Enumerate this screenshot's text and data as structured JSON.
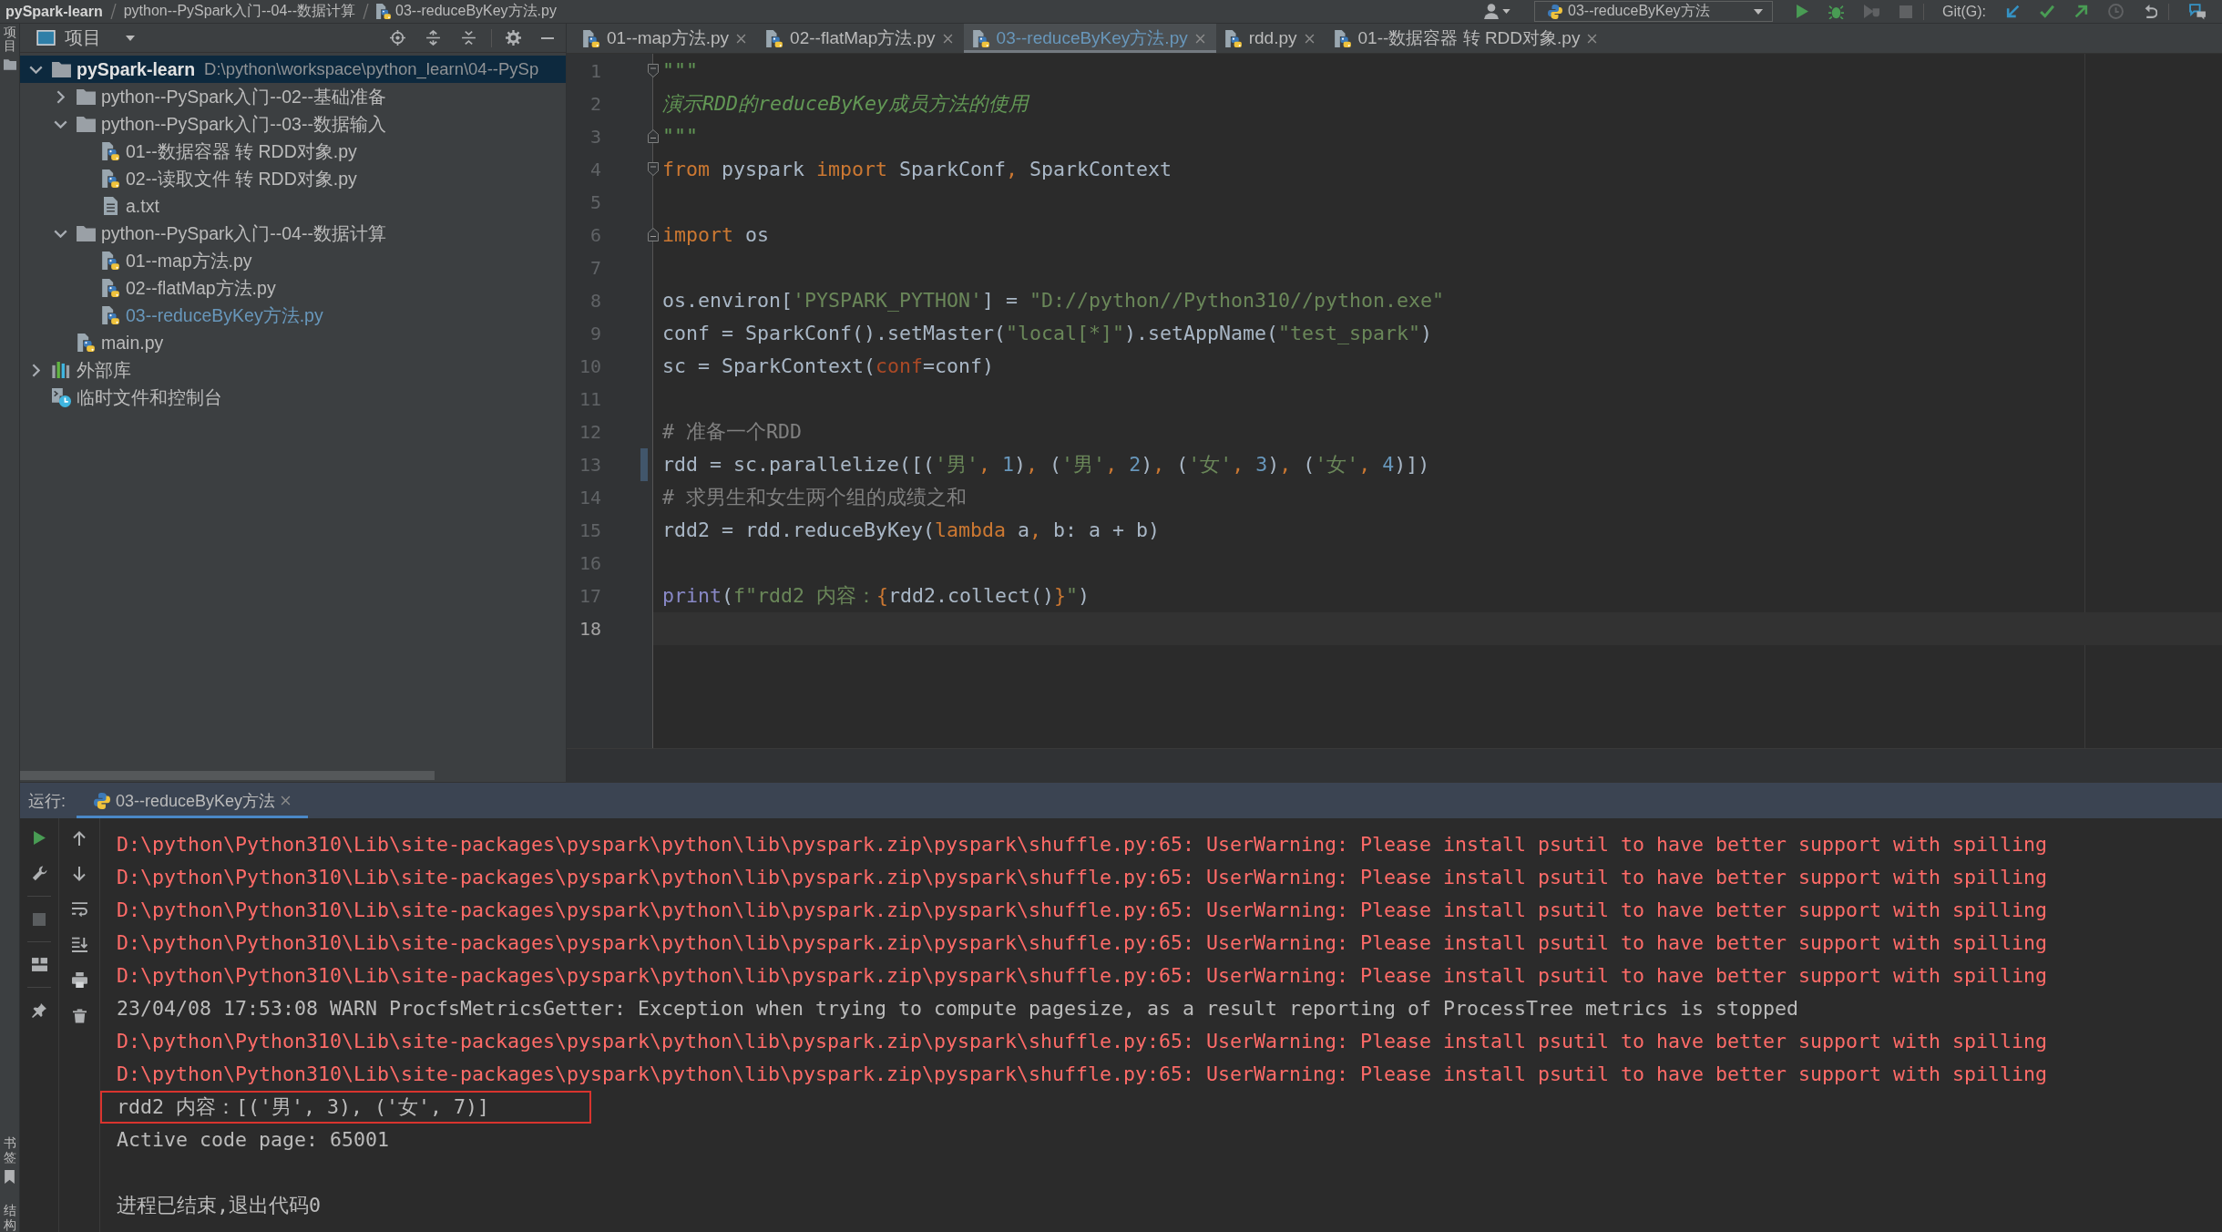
{
  "title_bar": {
    "breadcrumbs": [
      {
        "label": "pySpark-learn",
        "kind": "project"
      },
      {
        "label": "python--PySpark入门--04--数据计算",
        "kind": "folder"
      },
      {
        "label": "03--reduceByKey方法.py",
        "kind": "python"
      }
    ],
    "run_config": {
      "label": "03--reduceByKey方法"
    },
    "vcs_label": "Git(G):"
  },
  "tool_strip": {
    "top": [
      {
        "label": "项目",
        "kind": "project"
      }
    ],
    "bottom": [
      {
        "label": "书签",
        "kind": "bookmarks"
      },
      {
        "label": "结构",
        "kind": "structure"
      }
    ]
  },
  "project_panel": {
    "title": "项目",
    "tree": [
      {
        "label": "pySpark-learn",
        "path": "D:\\python\\workspace\\python_learn\\04--PySp",
        "kind": "project",
        "expanded": true,
        "selected": true,
        "modified": false,
        "children": [
          {
            "label": "python--PySpark入门--02--基础准备",
            "kind": "folder",
            "expanded": false,
            "selected": false,
            "modified": false
          },
          {
            "label": "python--PySpark入门--03--数据输入",
            "kind": "folder",
            "expanded": true,
            "selected": false,
            "modified": false,
            "children": [
              {
                "label": "01--数据容器 转 RDD对象.py",
                "kind": "python",
                "selected": false,
                "modified": false
              },
              {
                "label": "02--读取文件 转 RDD对象.py",
                "kind": "python",
                "selected": false,
                "modified": false
              },
              {
                "label": "a.txt",
                "kind": "text",
                "selected": false,
                "modified": false
              }
            ]
          },
          {
            "label": "python--PySpark入门--04--数据计算",
            "kind": "folder",
            "expanded": true,
            "selected": false,
            "modified": false,
            "children": [
              {
                "label": "01--map方法.py",
                "kind": "python",
                "selected": false,
                "modified": false
              },
              {
                "label": "02--flatMap方法.py",
                "kind": "python",
                "selected": false,
                "modified": false
              },
              {
                "label": "03--reduceByKey方法.py",
                "kind": "python",
                "selected": false,
                "modified": true
              }
            ]
          },
          {
            "label": "main.py",
            "kind": "python",
            "selected": false,
            "modified": false
          }
        ]
      },
      {
        "label": "外部库",
        "kind": "library",
        "expanded": false,
        "selected": false,
        "modified": false
      },
      {
        "label": "临时文件和控制台",
        "kind": "scratch",
        "selected": false,
        "modified": false
      }
    ]
  },
  "editor": {
    "tabs": [
      {
        "label": "01--map方法.py",
        "selected": false,
        "modified": false
      },
      {
        "label": "02--flatMap方法.py",
        "selected": false,
        "modified": false
      },
      {
        "label": "03--reduceByKey方法.py",
        "selected": true,
        "modified": true
      },
      {
        "label": "rdd.py",
        "selected": false,
        "modified": false
      },
      {
        "label": "01--数据容器 转 RDD对象.py",
        "selected": false,
        "modified": false
      }
    ],
    "lines": [
      {
        "number": "1",
        "fold_start": true,
        "fold_end": false,
        "current": false,
        "changed": false,
        "tokens": [
          {
            "kind": "docstring",
            "text": "\"\"\""
          }
        ]
      },
      {
        "number": "2",
        "fold_start": false,
        "fold_end": false,
        "current": false,
        "changed": false,
        "tokens": [
          {
            "kind": "docstring",
            "text": "演示RDD的reduceByKey成员方法的使用"
          }
        ]
      },
      {
        "number": "3",
        "fold_start": false,
        "fold_end": true,
        "current": false,
        "changed": false,
        "tokens": [
          {
            "kind": "docstring",
            "text": "\"\"\""
          }
        ]
      },
      {
        "number": "4",
        "fold_start": true,
        "fold_end": false,
        "current": false,
        "changed": false,
        "tokens": [
          {
            "kind": "keyword",
            "text": "from"
          },
          {
            "kind": "plain",
            "text": " pyspark "
          },
          {
            "kind": "keyword",
            "text": "import"
          },
          {
            "kind": "plain",
            "text": " SparkConf"
          },
          {
            "kind": "keyword",
            "text": ","
          },
          {
            "kind": "plain",
            "text": " SparkContext"
          }
        ]
      },
      {
        "number": "5",
        "fold_start": false,
        "fold_end": false,
        "current": false,
        "changed": false
      },
      {
        "number": "6",
        "fold_start": false,
        "fold_end": true,
        "current": false,
        "changed": false,
        "tokens": [
          {
            "kind": "keyword",
            "text": "import"
          },
          {
            "kind": "plain",
            "text": " os"
          }
        ]
      },
      {
        "number": "7",
        "fold_start": false,
        "fold_end": false,
        "current": false,
        "changed": false
      },
      {
        "number": "8",
        "fold_start": false,
        "fold_end": false,
        "current": false,
        "changed": false,
        "tokens": [
          {
            "kind": "plain",
            "text": "os.environ["
          },
          {
            "kind": "string",
            "text": "'PYSPARK_PYTHON'"
          },
          {
            "kind": "plain",
            "text": "] = "
          },
          {
            "kind": "string",
            "text": "\"D://python//Python310//python.exe\""
          }
        ]
      },
      {
        "number": "9",
        "fold_start": false,
        "fold_end": false,
        "current": false,
        "changed": false,
        "tokens": [
          {
            "kind": "plain",
            "text": "conf = SparkConf().setMaster("
          },
          {
            "kind": "string",
            "text": "\"local[*]\""
          },
          {
            "kind": "plain",
            "text": ").setAppName("
          },
          {
            "kind": "string",
            "text": "\"test_spark\""
          },
          {
            "kind": "plain",
            "text": ")"
          }
        ]
      },
      {
        "number": "10",
        "fold_start": false,
        "fold_end": false,
        "current": false,
        "changed": false,
        "tokens": [
          {
            "kind": "plain",
            "text": "sc = SparkContext("
          },
          {
            "kind": "param",
            "text": "conf"
          },
          {
            "kind": "plain",
            "text": "=conf)"
          }
        ]
      },
      {
        "number": "11",
        "fold_start": false,
        "fold_end": false,
        "current": false,
        "changed": false
      },
      {
        "number": "12",
        "fold_start": false,
        "fold_end": false,
        "current": false,
        "changed": false,
        "tokens": [
          {
            "kind": "comment",
            "text": "# 准备一个RDD"
          }
        ]
      },
      {
        "number": "13",
        "fold_start": false,
        "fold_end": false,
        "current": false,
        "changed": true,
        "tokens": [
          {
            "kind": "plain",
            "text": "rdd = sc.parallelize([("
          },
          {
            "kind": "string",
            "text": "'男'"
          },
          {
            "kind": "keyword",
            "text": ","
          },
          {
            "kind": "number",
            "text": " 1"
          },
          {
            "kind": "plain",
            "text": ")"
          },
          {
            "kind": "keyword",
            "text": ","
          },
          {
            "kind": "plain",
            "text": " ("
          },
          {
            "kind": "string",
            "text": "'男'"
          },
          {
            "kind": "keyword",
            "text": ","
          },
          {
            "kind": "number",
            "text": " 2"
          },
          {
            "kind": "plain",
            "text": ")"
          },
          {
            "kind": "keyword",
            "text": ","
          },
          {
            "kind": "plain",
            "text": " ("
          },
          {
            "kind": "string",
            "text": "'女'"
          },
          {
            "kind": "keyword",
            "text": ","
          },
          {
            "kind": "number",
            "text": " 3"
          },
          {
            "kind": "plain",
            "text": ")"
          },
          {
            "kind": "keyword",
            "text": ","
          },
          {
            "kind": "plain",
            "text": " ("
          },
          {
            "kind": "string",
            "text": "'女'"
          },
          {
            "kind": "keyword",
            "text": ","
          },
          {
            "kind": "number",
            "text": " 4"
          },
          {
            "kind": "plain",
            "text": ")])"
          }
        ]
      },
      {
        "number": "14",
        "fold_start": false,
        "fold_end": false,
        "current": false,
        "changed": false,
        "tokens": [
          {
            "kind": "comment",
            "text": "# 求男生和女生两个组的成绩之和"
          }
        ]
      },
      {
        "number": "15",
        "fold_start": false,
        "fold_end": false,
        "current": false,
        "changed": false,
        "tokens": [
          {
            "kind": "plain",
            "text": "rdd2 = rdd.reduceByKey("
          },
          {
            "kind": "keyword",
            "text": "lambda"
          },
          {
            "kind": "plain",
            "text": " a"
          },
          {
            "kind": "keyword",
            "text": ","
          },
          {
            "kind": "plain",
            "text": " b: a + b)"
          }
        ]
      },
      {
        "number": "16",
        "fold_start": false,
        "fold_end": false,
        "current": false,
        "changed": false
      },
      {
        "number": "17",
        "fold_start": false,
        "fold_end": false,
        "current": false,
        "changed": false,
        "tokens": [
          {
            "kind": "builtin",
            "text": "print"
          },
          {
            "kind": "plain",
            "text": "("
          },
          {
            "kind": "string",
            "text": "f\"rdd2 内容："
          },
          {
            "kind": "keyword",
            "text": "{"
          },
          {
            "kind": "plain",
            "text": "rdd2.collect()"
          },
          {
            "kind": "keyword",
            "text": "}"
          },
          {
            "kind": "string",
            "text": "\""
          },
          {
            "kind": "plain",
            "text": ")"
          }
        ]
      },
      {
        "number": "18",
        "fold_start": false,
        "fold_end": false,
        "current": true,
        "changed": false
      }
    ]
  },
  "run_panel": {
    "label": "运行:",
    "tabs": [
      {
        "label": "03--reduceByKey方法",
        "selected": true
      }
    ],
    "console": [
      {
        "kind": "error",
        "boxed": false,
        "text": "D:\\python\\Python310\\Lib\\site-packages\\pyspark\\python\\lib\\pyspark.zip\\pyspark\\shuffle.py:65: UserWarning: Please install psutil to have better support with spilling"
      },
      {
        "kind": "error",
        "boxed": false,
        "text": "D:\\python\\Python310\\Lib\\site-packages\\pyspark\\python\\lib\\pyspark.zip\\pyspark\\shuffle.py:65: UserWarning: Please install psutil to have better support with spilling"
      },
      {
        "kind": "error",
        "boxed": false,
        "text": "D:\\python\\Python310\\Lib\\site-packages\\pyspark\\python\\lib\\pyspark.zip\\pyspark\\shuffle.py:65: UserWarning: Please install psutil to have better support with spilling"
      },
      {
        "kind": "error",
        "boxed": false,
        "text": "D:\\python\\Python310\\Lib\\site-packages\\pyspark\\python\\lib\\pyspark.zip\\pyspark\\shuffle.py:65: UserWarning: Please install psutil to have better support with spilling"
      },
      {
        "kind": "error",
        "boxed": false,
        "text": "D:\\python\\Python310\\Lib\\site-packages\\pyspark\\python\\lib\\pyspark.zip\\pyspark\\shuffle.py:65: UserWarning: Please install psutil to have better support with spilling"
      },
      {
        "kind": "output",
        "boxed": false,
        "text": "23/04/08 17:53:08 WARN ProcfsMetricsGetter: Exception when trying to compute pagesize, as a result reporting of ProcessTree metrics is stopped"
      },
      {
        "kind": "error",
        "boxed": false,
        "text": "D:\\python\\Python310\\Lib\\site-packages\\pyspark\\python\\lib\\pyspark.zip\\pyspark\\shuffle.py:65: UserWarning: Please install psutil to have better support with spilling"
      },
      {
        "kind": "error",
        "boxed": false,
        "text": "D:\\python\\Python310\\Lib\\site-packages\\pyspark\\python\\lib\\pyspark.zip\\pyspark\\shuffle.py:65: UserWarning: Please install psutil to have better support with spilling"
      },
      {
        "kind": "output",
        "boxed": true,
        "text": "rdd2 内容：[('男', 3), ('女', 7)]"
      },
      {
        "kind": "output",
        "boxed": false,
        "text": "Active code page: 65001"
      },
      {
        "kind": "exit",
        "boxed": false,
        "text": "进程已结束,退出代码0"
      }
    ]
  }
}
